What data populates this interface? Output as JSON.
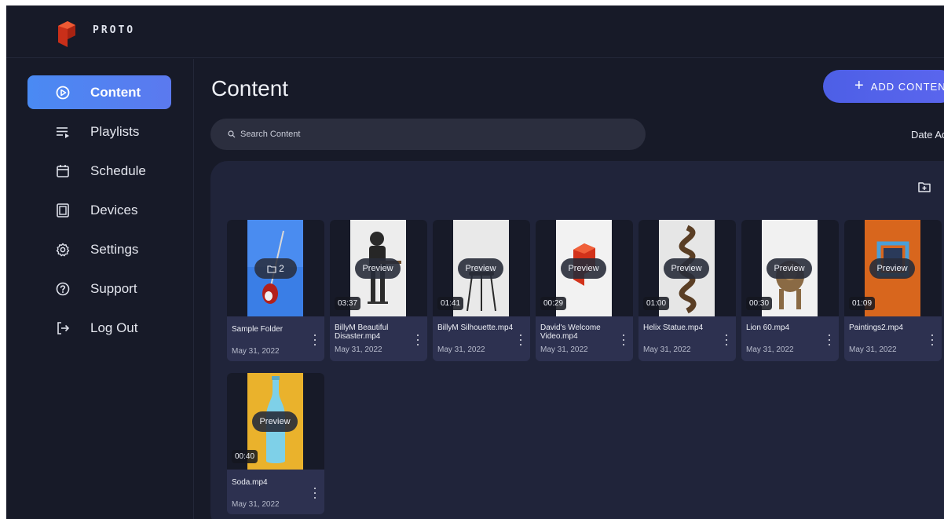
{
  "app": {
    "brand": "PROTO",
    "brand_color": "#e0391f"
  },
  "sidebar": {
    "items": [
      {
        "label": "Content",
        "icon": "play-circle-icon",
        "active": true
      },
      {
        "label": "Playlists",
        "icon": "playlist-icon",
        "active": false
      },
      {
        "label": "Schedule",
        "icon": "calendar-icon",
        "active": false
      },
      {
        "label": "Devices",
        "icon": "device-icon",
        "active": false
      },
      {
        "label": "Settings",
        "icon": "gear-icon",
        "active": false
      },
      {
        "label": "Support",
        "icon": "help-circle-icon",
        "active": false
      },
      {
        "label": "Log Out",
        "icon": "logout-icon",
        "active": false
      }
    ]
  },
  "main": {
    "title": "Content",
    "add_button": "ADD CONTENT",
    "search": {
      "placeholder": "Search Content"
    },
    "sort_label": "Date Added",
    "accent": "#4a8af3"
  },
  "cards": [
    {
      "name": "Sample Folder",
      "date": "May 31, 2022",
      "type": "folder",
      "count": "2"
    },
    {
      "name": "BillyM Beautiful Disaster.mp4",
      "date": "May 31, 2022",
      "type": "video",
      "duration": "03:37",
      "preview": "Preview"
    },
    {
      "name": "BillyM Silhouette.mp4",
      "date": "May 31, 2022",
      "type": "video",
      "duration": "01:41",
      "preview": "Preview"
    },
    {
      "name": "David's Welcome Video.mp4",
      "date": "May 31, 2022",
      "type": "video",
      "duration": "00:29",
      "preview": "Preview"
    },
    {
      "name": "Helix Statue.mp4",
      "date": "May 31, 2022",
      "type": "video",
      "duration": "01:00",
      "preview": "Preview"
    },
    {
      "name": "Lion 60.mp4",
      "date": "May 31, 2022",
      "type": "video",
      "duration": "00:30",
      "preview": "Preview"
    },
    {
      "name": "Paintings2.mp4",
      "date": "May 31, 2022",
      "type": "video",
      "duration": "01:09",
      "preview": "Preview"
    },
    {
      "name": "Soda.mp4",
      "date": "May 31, 2022",
      "type": "video",
      "duration": "00:40",
      "preview": "Preview"
    }
  ]
}
